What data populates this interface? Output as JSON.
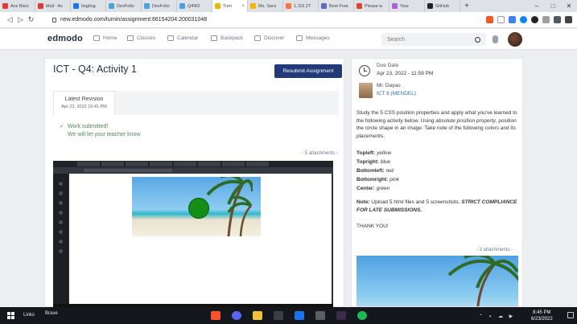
{
  "browser": {
    "tabs": [
      {
        "label": "Ace Baro",
        "color": "#e53935",
        "active": false
      },
      {
        "label": "Muli - Ac",
        "color": "#e53935",
        "active": false
      },
      {
        "label": "tingting",
        "color": "#1877f2",
        "active": false
      },
      {
        "label": "DevFolio",
        "color": "#4aa3df",
        "active": false
      },
      {
        "label": "DevFolio",
        "color": "#4aa3df",
        "active": false
      },
      {
        "label": "Q4W2",
        "color": "#4aa3df",
        "active": false
      },
      {
        "label": "Turn",
        "color": "#f5b400",
        "active": true
      },
      {
        "label": "Ms. Sara",
        "color": "#f5b400",
        "active": false
      },
      {
        "label": "1,116.27",
        "color": "#ff7043",
        "active": false
      },
      {
        "label": "Best Free",
        "color": "#5c6bc0",
        "active": false
      },
      {
        "label": "Please w",
        "color": "#db4437",
        "active": false
      },
      {
        "label": "Your",
        "color": "#aa5fdc",
        "active": false
      },
      {
        "label": "GitHub",
        "color": "#222222",
        "active": false
      }
    ],
    "new_tab_label": "+",
    "url": "new.edmodo.com/turnin/assignment:66154204:200031048"
  },
  "header": {
    "logo": "edmodo",
    "nav": [
      {
        "key": "home",
        "label": "Home"
      },
      {
        "key": "classes",
        "label": "Classes"
      },
      {
        "key": "calendar",
        "label": "Calendar"
      },
      {
        "key": "backpack",
        "label": "Backpack"
      },
      {
        "key": "discover",
        "label": "Discover"
      },
      {
        "key": "messages",
        "label": "Messages"
      }
    ],
    "search_placeholder": "Search"
  },
  "assignment": {
    "title": "ICT - Q4: Activity 1",
    "resubmit_label": "Resubmit Assignment",
    "revision_label": "Latest Revision",
    "revision_date": "Apr 23, 2022 10:41 PM",
    "submitted_text": "Work submitted!",
    "teacher_note": "We will let your teacher know",
    "attachments_label": "- 5 attachments -"
  },
  "details": {
    "due_label": "Due Date",
    "due_date": "Apr 23, 2022 - 11:59 PM",
    "teacher_name": "Mr. Dayao",
    "class_name": "ICT 8 (MENDEL)",
    "instructions_1": "Study the 5 CSS position properties and apply what you've learned to the following activity below. Using ",
    "instructions_em1": "absolute position property",
    "instructions_2": ", position the circle shape in an image. Take note of the following colors and its placements.",
    "positions": [
      {
        "key": "Topleft:",
        "value": "yellow"
      },
      {
        "key": "Topright:",
        "value": "blue"
      },
      {
        "key": "Bottomleft:",
        "value": "red"
      },
      {
        "key": "Bottomright:",
        "value": "pink"
      },
      {
        "key": "Center:",
        "value": "green"
      }
    ],
    "note_label": "Note:",
    "note_text": " Upload 5 html files and 5 screenshots. ",
    "note_strong": "STRICT COMPLIANCE FOR LATE SUBMISSIONS.",
    "thanks": "THANK YOU!",
    "attachments_label": "- 3 attachments -"
  },
  "taskbar": {
    "links_label": "Links",
    "brave_label": "Brave",
    "time": "8:45 PM",
    "date": "6/23/2022"
  }
}
